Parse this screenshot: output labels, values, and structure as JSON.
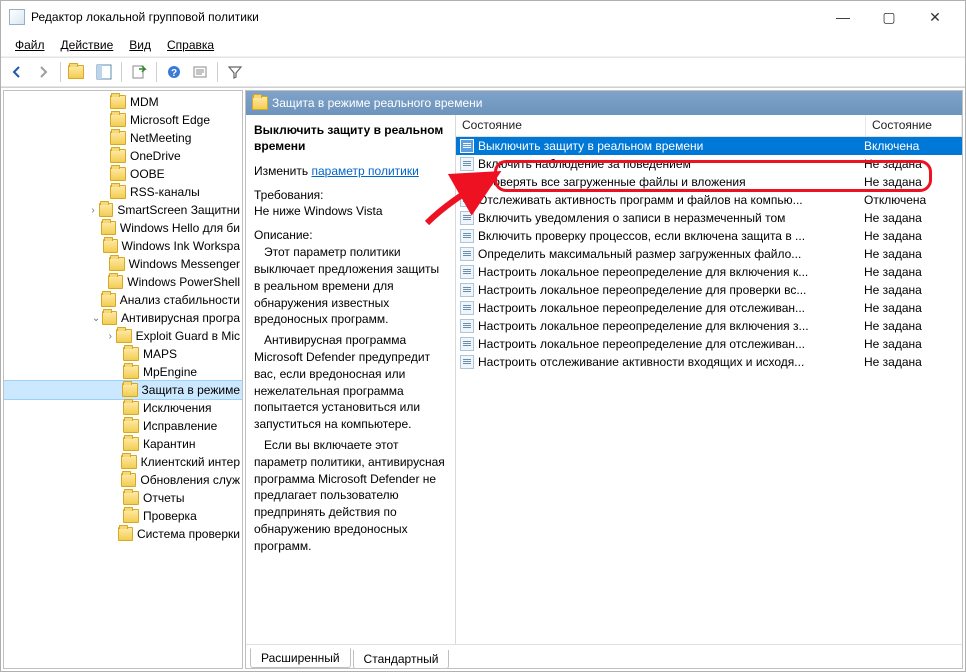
{
  "window": {
    "title": "Редактор локальной групповой политики",
    "controls": {
      "minimize": "—",
      "maximize": "▢",
      "close": "✕"
    }
  },
  "menu": {
    "file": "Файл",
    "action": "Действие",
    "view": "Вид",
    "help": "Справка"
  },
  "toolbar_icons": {
    "back": "arrow-left-icon",
    "forward": "arrow-right-icon",
    "up": "folder-up-icon",
    "tree_toggle": "tree-toggle-icon",
    "export": "export-list-icon",
    "help": "help-icon",
    "props": "properties-icon",
    "filter": "filter-icon"
  },
  "tree": {
    "items": [
      {
        "label": "MDM",
        "indent": 7
      },
      {
        "label": "Microsoft Edge",
        "indent": 7
      },
      {
        "label": "NetMeeting",
        "indent": 7
      },
      {
        "label": "OneDrive",
        "indent": 7
      },
      {
        "label": "OOBE",
        "indent": 7
      },
      {
        "label": "RSS-каналы",
        "indent": 7
      },
      {
        "label": "SmartScreen Защитни",
        "indent": 7,
        "expander": ">"
      },
      {
        "label": "Windows Hello для би",
        "indent": 7
      },
      {
        "label": "Windows Ink Workspa",
        "indent": 7
      },
      {
        "label": "Windows Messenger",
        "indent": 7
      },
      {
        "label": "Windows PowerShell",
        "indent": 7
      },
      {
        "label": "Анализ стабильности",
        "indent": 7
      },
      {
        "label": "Антивирусная програ",
        "indent": 7,
        "expander": "v"
      },
      {
        "label": "Exploit Guard в Mic",
        "indent": 8,
        "expander": ">"
      },
      {
        "label": "MAPS",
        "indent": 8
      },
      {
        "label": "MpEngine",
        "indent": 8
      },
      {
        "label": "Защита в режиме",
        "indent": 8,
        "selected": true
      },
      {
        "label": "Исключения",
        "indent": 8
      },
      {
        "label": "Исправление",
        "indent": 8
      },
      {
        "label": "Карантин",
        "indent": 8
      },
      {
        "label": "Клиентский интер",
        "indent": 8
      },
      {
        "label": "Обновления служ",
        "indent": 8
      },
      {
        "label": "Отчеты",
        "indent": 8
      },
      {
        "label": "Проверка",
        "indent": 8
      },
      {
        "label": "Система проверки",
        "indent": 8
      }
    ]
  },
  "pane": {
    "header": "Защита в режиме реального времени",
    "task": {
      "title": "Выключить защиту в реальном времени",
      "edit_label": "Изменить",
      "policy_link": "параметр политики",
      "req_h": "Требования:",
      "req_text": "Не ниже Windows Vista",
      "desc_h": "Описание:",
      "desc_p1": "Этот параметр политики выключает предложения защиты в реальном времени для обнаружения известных вредоносных программ.",
      "desc_p2": "Антивирусная программа Microsoft Defender предупредит вас, если вредоносная или нежелательная программа попытается установиться или запуститься на компьютере.",
      "desc_p3": "Если вы включаете этот параметр политики, антивирусная программа Microsoft Defender не предлагает пользователю предпринять действия по обнаружению вредоносных программ."
    },
    "list": {
      "col_name": "Состояние",
      "col_state": "Состояние",
      "rows": [
        {
          "name": "Выключить защиту в реальном времени",
          "state": "Включена",
          "selected": true
        },
        {
          "name": "Включить наблюдение за поведением",
          "state": "Не задана"
        },
        {
          "name": "Проверять все загруженные файлы и вложения",
          "state": "Не задана"
        },
        {
          "name": "Отслеживать активность программ и файлов на компью...",
          "state": "Отключена"
        },
        {
          "name": "Включить уведомления о записи в неразмеченный том",
          "state": "Не задана"
        },
        {
          "name": "Включить проверку процессов, если включена защита в ...",
          "state": "Не задана"
        },
        {
          "name": "Определить максимальный размер загруженных файло...",
          "state": "Не задана"
        },
        {
          "name": "Настроить локальное переопределение для включения к...",
          "state": "Не задана"
        },
        {
          "name": "Настроить локальное переопределение для проверки вс...",
          "state": "Не задана"
        },
        {
          "name": "Настроить локальное переопределение для отслеживан...",
          "state": "Не задана"
        },
        {
          "name": "Настроить локальное переопределение для включения з...",
          "state": "Не задана"
        },
        {
          "name": "Настроить локальное переопределение для отслеживан...",
          "state": "Не задана"
        },
        {
          "name": "Настроить отслеживание активности входящих и исходя...",
          "state": "Не задана"
        }
      ]
    },
    "tabs": {
      "extended": "Расширенный",
      "standard": "Стандартный"
    }
  },
  "callout": {
    "present": true
  }
}
